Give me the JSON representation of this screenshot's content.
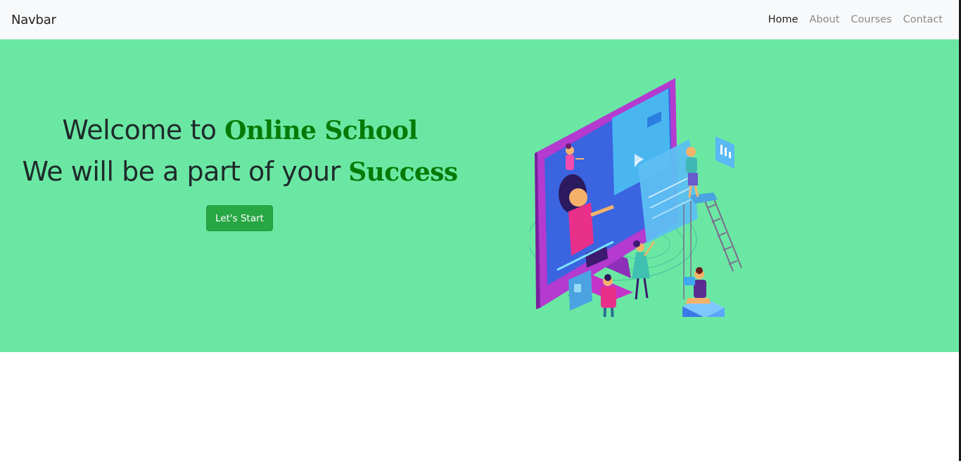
{
  "navbar": {
    "brand": "Navbar",
    "links": [
      "Home",
      "About",
      "Courses",
      "Contact"
    ]
  },
  "hero": {
    "line1_prefix": "Welcome to ",
    "line1_highlight": "Online School",
    "line2_prefix": "We will be a part of your ",
    "line2_highlight": "Success",
    "button_label": "Let's Start"
  },
  "colors": {
    "navbar_bg": "#f8f9fa",
    "hero_bg": "#6ae8a3",
    "highlight": "#067a06",
    "button": "#28a745"
  }
}
